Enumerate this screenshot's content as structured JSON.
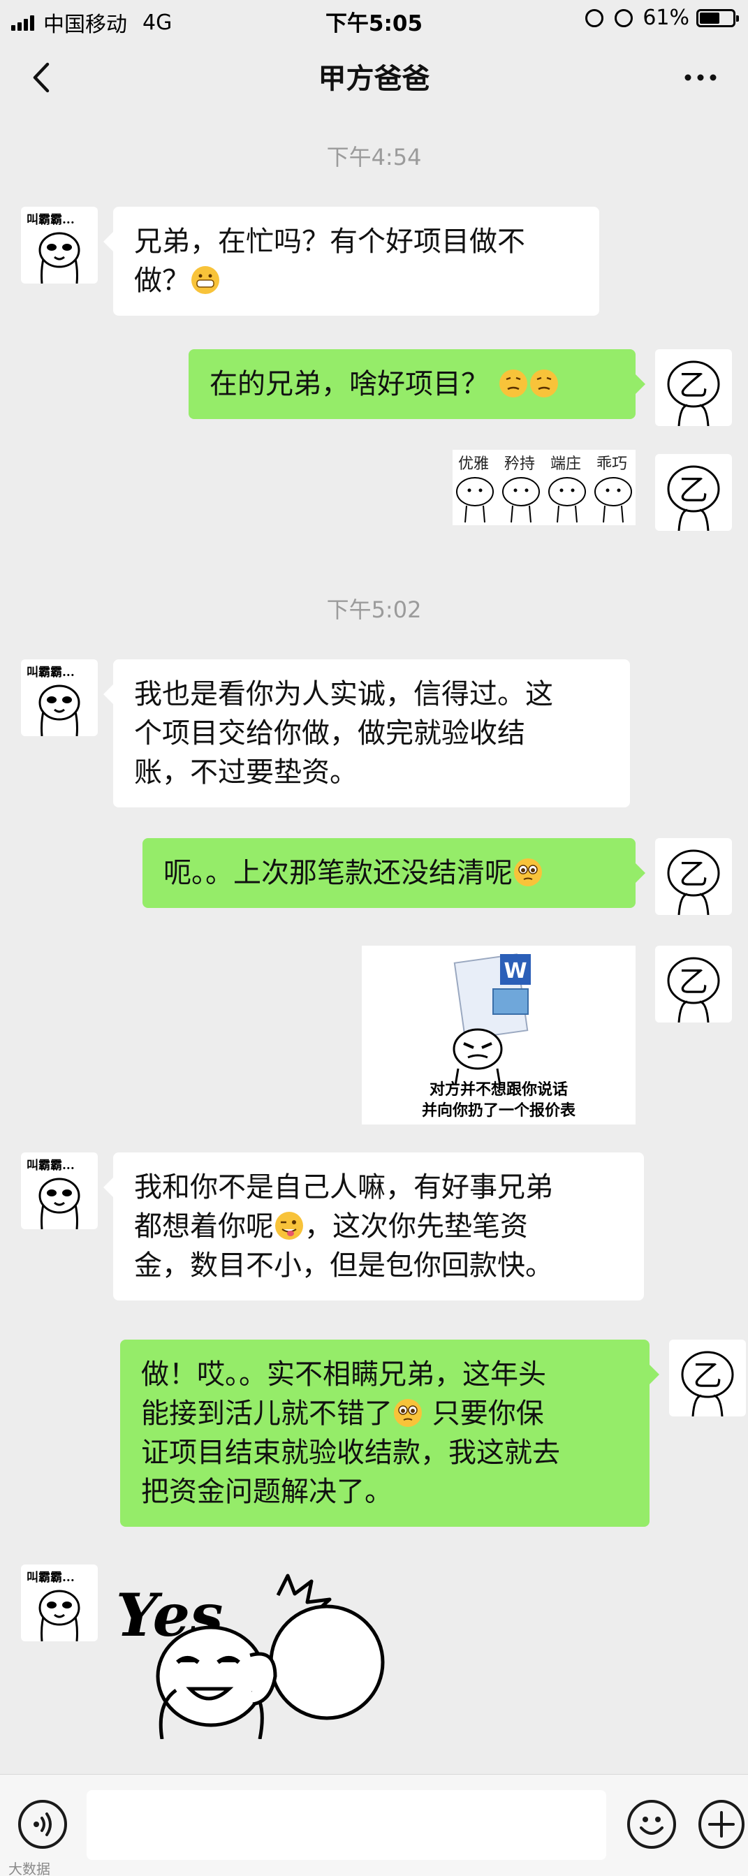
{
  "status_bar": {
    "carrier": "中国移动",
    "network": "4G",
    "time": "下午5:05",
    "battery": "61%",
    "battery_level": 0.61
  },
  "header": {
    "title": "甲方爸爸",
    "back_icon": "chevron-left-icon",
    "more_icon": "more-dots-icon"
  },
  "avatars": {
    "contact_label": "叫霸霸...",
    "self_char": "乙"
  },
  "messages": {
    "t1": "下午4:54",
    "m1": "兄弟，在忙吗？有个好项目做不\n做？",
    "m2": "在的兄弟，啥好项目？",
    "stickers": [
      "优雅",
      "矜持",
      "端庄",
      "乖巧"
    ],
    "t2": "下午5:02",
    "m3": "我也是看你为人实诚，信得过。这\n个项目交给你做，做完就验收结\n账，不过要垫资。",
    "m4": "呃。。上次那笔款还没结清呢",
    "meme_line1": "对方并不想跟你说话",
    "meme_line2": "并向你扔了一个报价表",
    "m5_a": "我和你不是自己人嘛，有好事兄弟\n都想着你呢",
    "m5_b": "，这次你先垫笔资\n金，数目不小，但是包你回款快。",
    "m6_a": "做！哎。。实不相瞒兄弟，这年头\n能接到活儿就不错了",
    "m6_b": " 只要你保\n证项目结束就验收结款，我这就去\n把资金问题解决了。",
    "yes_sticker": "Yes"
  },
  "input_bar": {
    "voice_icon": "voice-icon",
    "emoji_icon": "emoji-icon",
    "plus_icon": "plus-icon",
    "placeholder": ""
  },
  "watermark": "大数据"
}
